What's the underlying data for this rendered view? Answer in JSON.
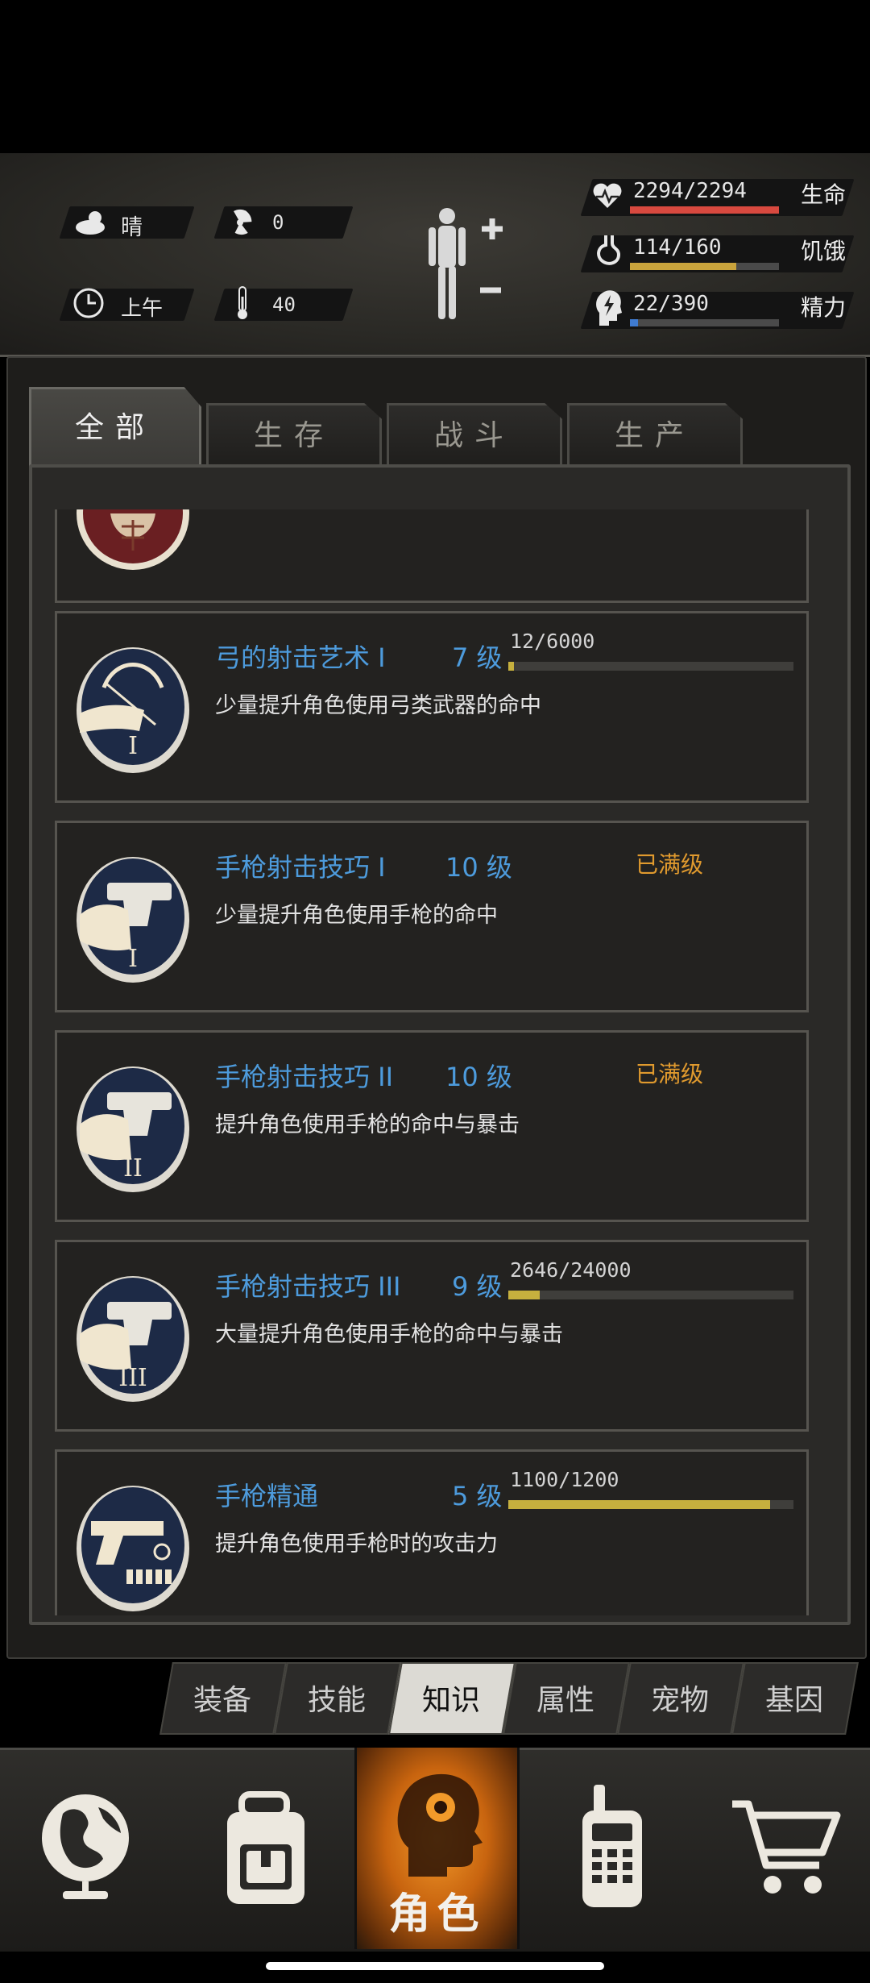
{
  "status": {
    "weather": "晴",
    "radiation": "0",
    "time_of_day": "上午",
    "temperature": "40",
    "stats": [
      {
        "label": "生命",
        "value": "2294/2294",
        "current": 2294,
        "max": 2294,
        "color": "#d8493f",
        "icon": "heart-icon"
      },
      {
        "label": "饥饿",
        "value": "114/160",
        "current": 114,
        "max": 160,
        "color": "#c9a33c",
        "icon": "stomach-icon"
      },
      {
        "label": "精力",
        "value": "22/390",
        "current": 22,
        "max": 390,
        "color": "#3f7bd0",
        "icon": "energy-head-icon"
      }
    ]
  },
  "category_tabs": [
    "全部",
    "生存",
    "战斗",
    "生产"
  ],
  "skills": [
    {
      "name": "弓的射击艺术 I",
      "level": "7 级",
      "desc": "少量提升角色使用弓类武器的命中",
      "exp": "12/6000",
      "progress": 0.002,
      "maxed": false,
      "icon": "bow-icon",
      "tier": "I"
    },
    {
      "name": "手枪射击技巧 I",
      "level": "10 级",
      "desc": "少量提升角色使用手枪的命中",
      "maxed_label": "已满级",
      "maxed": true,
      "icon": "pistol-icon",
      "tier": "I"
    },
    {
      "name": "手枪射击技巧 II",
      "level": "10 级",
      "desc": "提升角色使用手枪的命中与暴击",
      "maxed_label": "已满级",
      "maxed": true,
      "icon": "pistol-icon",
      "tier": "II"
    },
    {
      "name": "手枪射击技巧 III",
      "level": "9 级",
      "desc": "大量提升角色使用手枪的命中与暴击",
      "exp": "2646/24000",
      "progress": 0.11,
      "maxed": false,
      "icon": "pistol-icon",
      "tier": "III"
    },
    {
      "name": "手枪精通",
      "level": "5 级",
      "desc": "提升角色使用手枪时的攻击力",
      "exp": "1100/1200",
      "progress": 0.917,
      "maxed": false,
      "icon": "pistol-ammo-icon",
      "tier": ""
    }
  ],
  "sub_tabs": [
    "装备",
    "技能",
    "知识",
    "属性",
    "宠物",
    "基因"
  ],
  "sub_tab_active": "知识",
  "bottom_nav": {
    "character_label": "角色"
  }
}
